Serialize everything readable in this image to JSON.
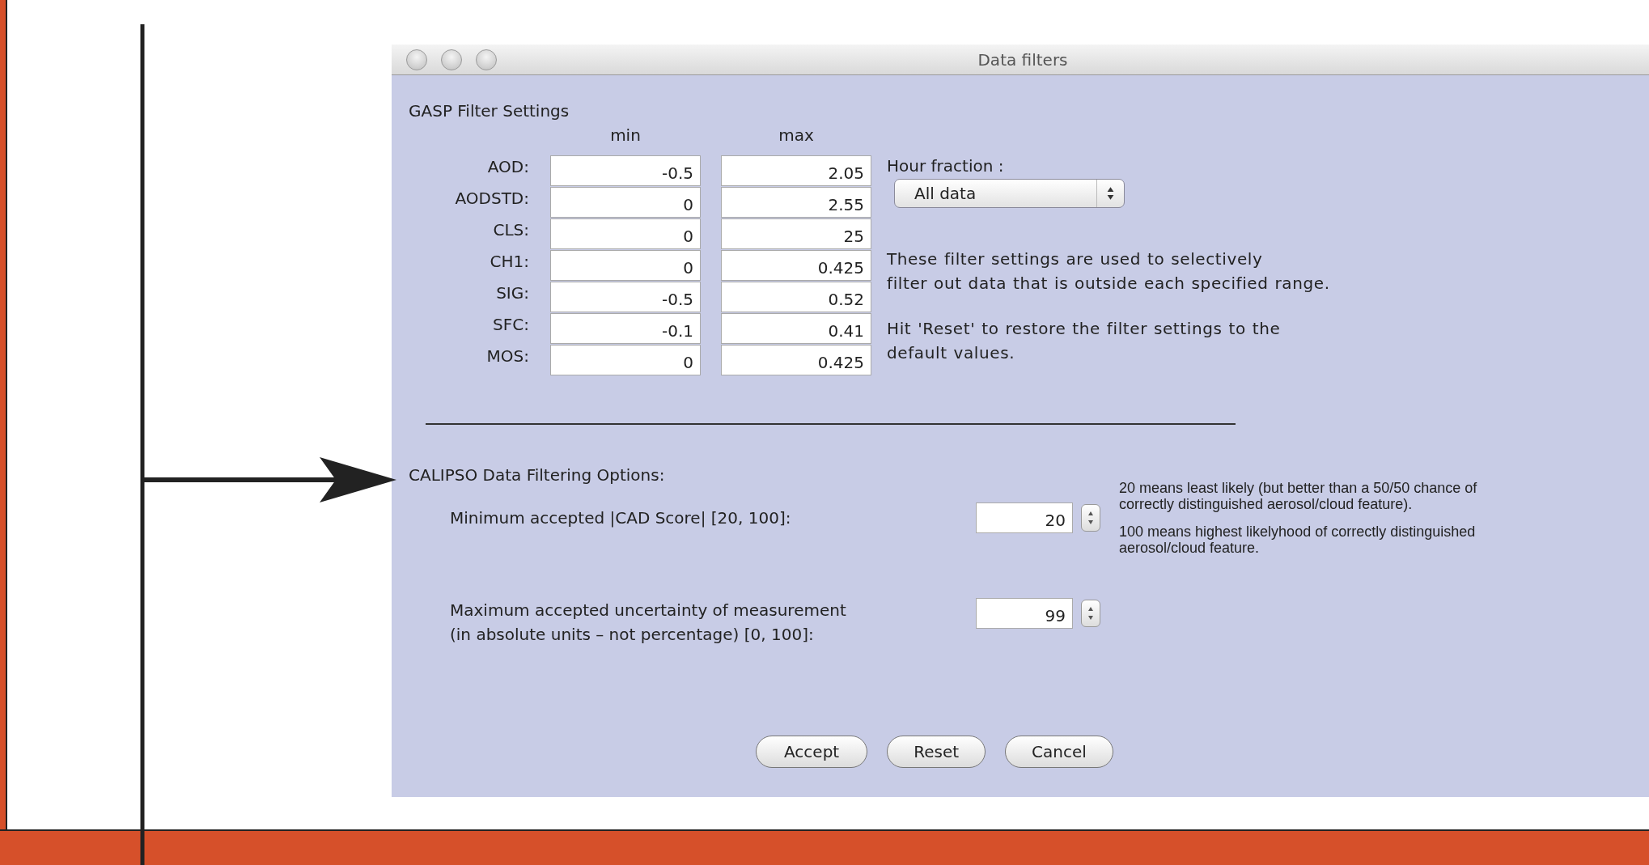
{
  "window": {
    "title": "Data filters"
  },
  "gasp": {
    "title": "GASP Filter Settings",
    "columns": [
      "min",
      "max"
    ],
    "rows": [
      {
        "label": "AOD:",
        "min": "-0.5",
        "max": "2.05"
      },
      {
        "label": "AODSTD:",
        "min": "0",
        "max": "2.55"
      },
      {
        "label": "CLS:",
        "min": "0",
        "max": "25"
      },
      {
        "label": "CH1:",
        "min": "0",
        "max": "0.425"
      },
      {
        "label": "SIG:",
        "min": "-0.5",
        "max": "0.52"
      },
      {
        "label": "SFC:",
        "min": "-0.1",
        "max": "0.41"
      },
      {
        "label": "MOS:",
        "min": "0",
        "max": "0.425"
      }
    ],
    "hour_fraction": {
      "label": "Hour fraction :",
      "value": "All data"
    },
    "description": [
      [
        "These filter settings are used to selectively",
        "filter out data that is outside each specified range."
      ],
      [
        "Hit 'Reset' to restore the filter settings to the",
        "default values."
      ]
    ]
  },
  "calipso": {
    "title": "CALIPSO Data Filtering Options:",
    "options": [
      {
        "label": [
          "Minimum accepted |CAD Score| [20, 100]:"
        ],
        "value": "20",
        "note": [
          [
            "20 means least likely (but better than a 50/50 chance of",
            "correctly distinguished aerosol/cloud feature)."
          ],
          [
            "100 means highest likelyhood of correctly distinguished",
            "aerosol/cloud feature."
          ]
        ]
      },
      {
        "label": [
          "Maximum accepted uncertainty of measurement",
          "(in absolute units – not percentage) [0, 100]:"
        ],
        "value": "99"
      }
    ]
  },
  "buttons": [
    "Accept",
    "Reset",
    "Cancel"
  ]
}
